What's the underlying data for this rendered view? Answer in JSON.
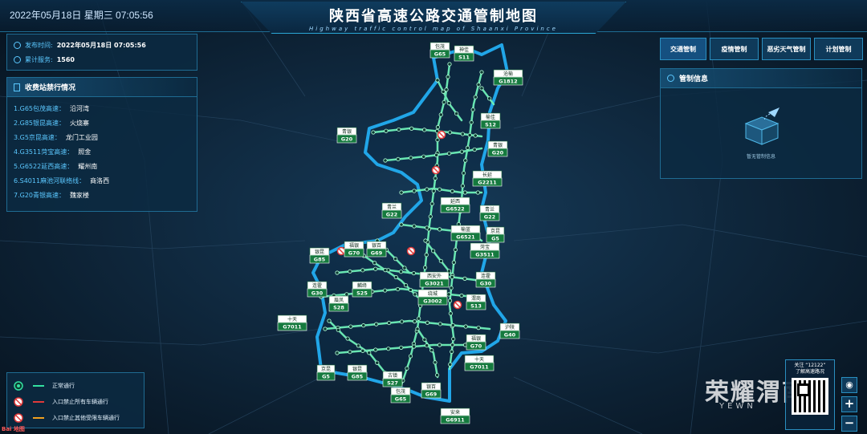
{
  "header": {
    "datetime": "2022年05月18日 星期三  07:05:56",
    "title": "陕西省高速公路交通管制地图",
    "subtitle": "Highway traffic control map of Shaanxi Province"
  },
  "info": {
    "publish_label": "发布时间:",
    "publish_value": "2022年05月18日 07:05:56",
    "service_label": "累计服务:",
    "service_value": "1560"
  },
  "stations": {
    "title": "收费站禁行情况",
    "items": [
      {
        "road": "1.G65包茂高速：",
        "name": "沿河湾"
      },
      {
        "road": "2.G85银昆高速：",
        "name": "火烧寨"
      },
      {
        "road": "3.G5京昆高速：",
        "name": "龙门工业园"
      },
      {
        "road": "4.G3511菏宝高速：",
        "name": "照金"
      },
      {
        "road": "5.G6522延西高速：",
        "name": "耀州南"
      },
      {
        "road": "6.S4011麻池河联络线：",
        "name": "商洛西"
      },
      {
        "road": "7.G20青银高速：",
        "name": "魏家楼"
      }
    ]
  },
  "tabs": [
    "交通管制",
    "疫情管制",
    "恶劣天气管制",
    "计划管制"
  ],
  "control": {
    "title": "管制信息",
    "empty_text": "暂无管制信息"
  },
  "legend": [
    {
      "label": "正常通行",
      "color": "#33e0a0"
    },
    {
      "label": "入口禁止所有车辆通行",
      "color": "#e03a3a"
    },
    {
      "label": "入口禁止其他受限车辆通行",
      "color": "#f0a020"
    }
  ],
  "watermark": {
    "text": "荣耀渭南",
    "sub": "YEWN"
  },
  "qr": {
    "line1": "关注 “12122”",
    "line2": "了解高速路况"
  },
  "zoom": {
    "in": "+",
    "out": "−"
  },
  "corner_logo": "Bai 地图",
  "shields": [
    {
      "name": "包茂",
      "code": "G65"
    },
    {
      "name": "神佳",
      "code": "S11"
    },
    {
      "name": "沧榆",
      "code": "G1812"
    },
    {
      "name": "榆佳",
      "code": "S12"
    },
    {
      "name": "青银",
      "code": "G20"
    },
    {
      "name": "青银",
      "code": "G20"
    },
    {
      "name": "长延",
      "code": "G2211"
    },
    {
      "name": "延西",
      "code": "G6522"
    },
    {
      "name": "青兰",
      "code": "G22"
    },
    {
      "name": "青兰",
      "code": "G22"
    },
    {
      "name": "榆蓝",
      "code": "G6521"
    },
    {
      "name": "京昆",
      "code": "G5"
    },
    {
      "name": "菏宝",
      "code": "G3511"
    },
    {
      "name": "福银",
      "code": "G70"
    },
    {
      "name": "银百",
      "code": "G69"
    },
    {
      "name": "银昆",
      "code": "G85"
    },
    {
      "name": "西安外",
      "code": "G3021"
    },
    {
      "name": "连霍",
      "code": "G30"
    },
    {
      "name": "麟绛",
      "code": "S25"
    },
    {
      "name": "连霍",
      "code": "G30"
    },
    {
      "name": "眉凤",
      "code": "S28"
    },
    {
      "name": "绕城",
      "code": "G3002"
    },
    {
      "name": "渭商",
      "code": "S13"
    },
    {
      "name": "十天",
      "code": "G7011"
    },
    {
      "name": "沪陕",
      "code": "G40"
    },
    {
      "name": "福银",
      "code": "G70"
    },
    {
      "name": "十天",
      "code": "G7011"
    },
    {
      "name": "京昆",
      "code": "G5"
    },
    {
      "name": "银昆",
      "code": "G85"
    },
    {
      "name": "古镇",
      "code": "S27"
    },
    {
      "name": "包茂",
      "code": "G65"
    },
    {
      "name": "银百",
      "code": "G69"
    },
    {
      "name": "安来",
      "code": "G6911"
    }
  ]
}
